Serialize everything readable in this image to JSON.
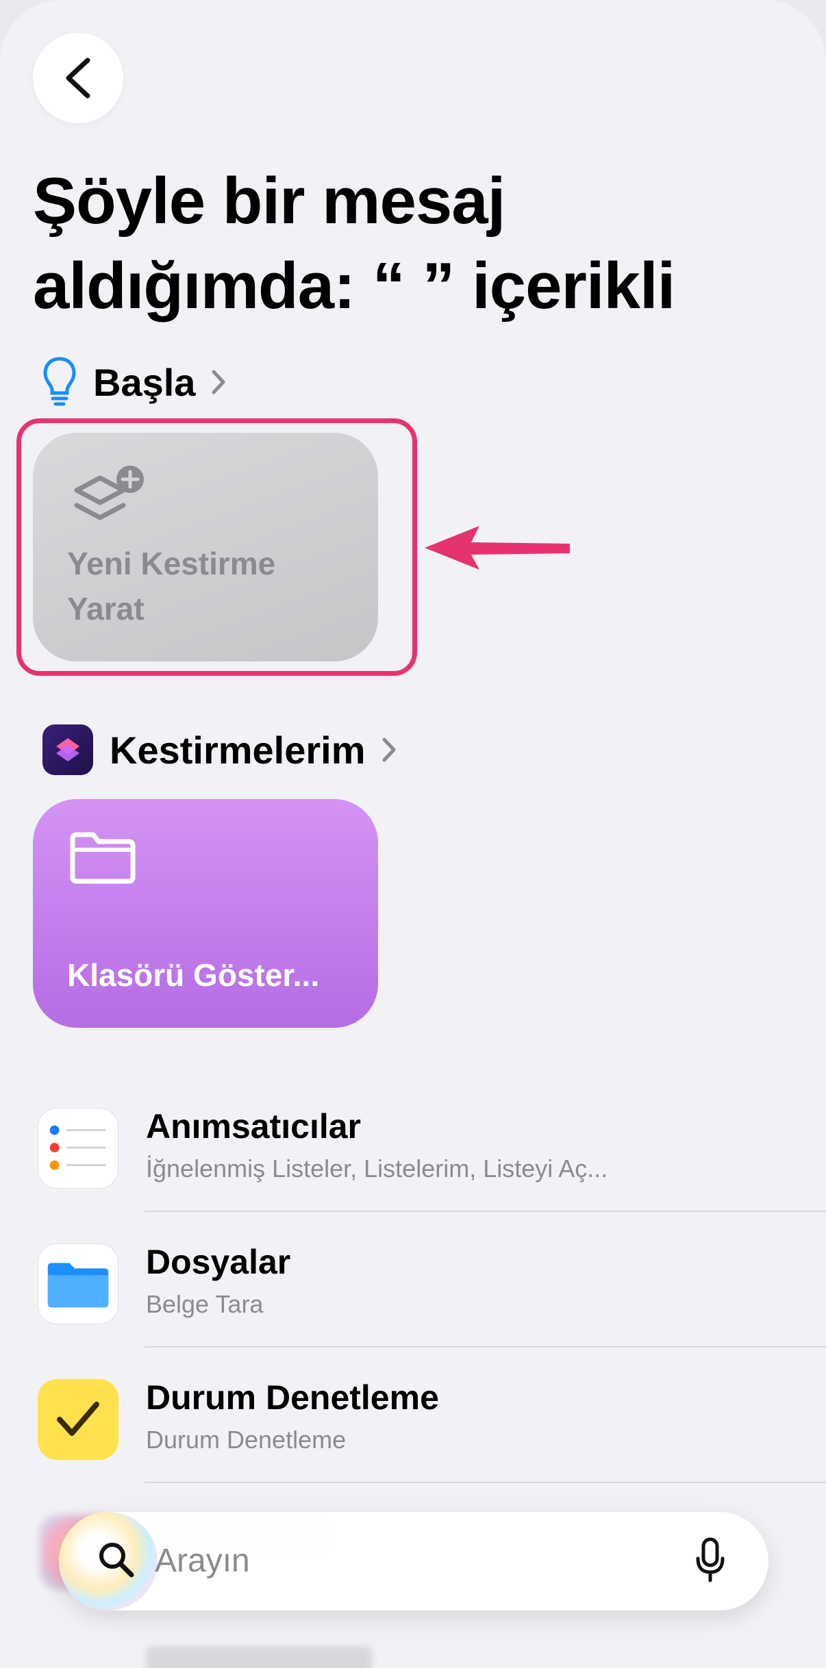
{
  "header": {
    "title": "Şöyle bir mesaj aldığımda: “ ” içerikli"
  },
  "start_section": {
    "label": "Başla"
  },
  "new_shortcut_tile": {
    "label": "Yeni Kestirme Yarat"
  },
  "my_shortcuts_section": {
    "label": "Kestirmelerim"
  },
  "folder_tile": {
    "label": "Klasörü Göster..."
  },
  "apps": [
    {
      "title": "Anımsatıcılar",
      "subtitle": "İğnelenmiş Listeler, Listelerim, Listeyi Aç..."
    },
    {
      "title": "Dosyalar",
      "subtitle": "Belge Tara"
    },
    {
      "title": "Durum Denetleme",
      "subtitle": "Durum Denetleme"
    }
  ],
  "search": {
    "placeholder": "Arayın"
  },
  "colors": {
    "highlight": "#e6336e",
    "folder_tile": "#c27ae9",
    "start_icon": "#1a8cff"
  }
}
